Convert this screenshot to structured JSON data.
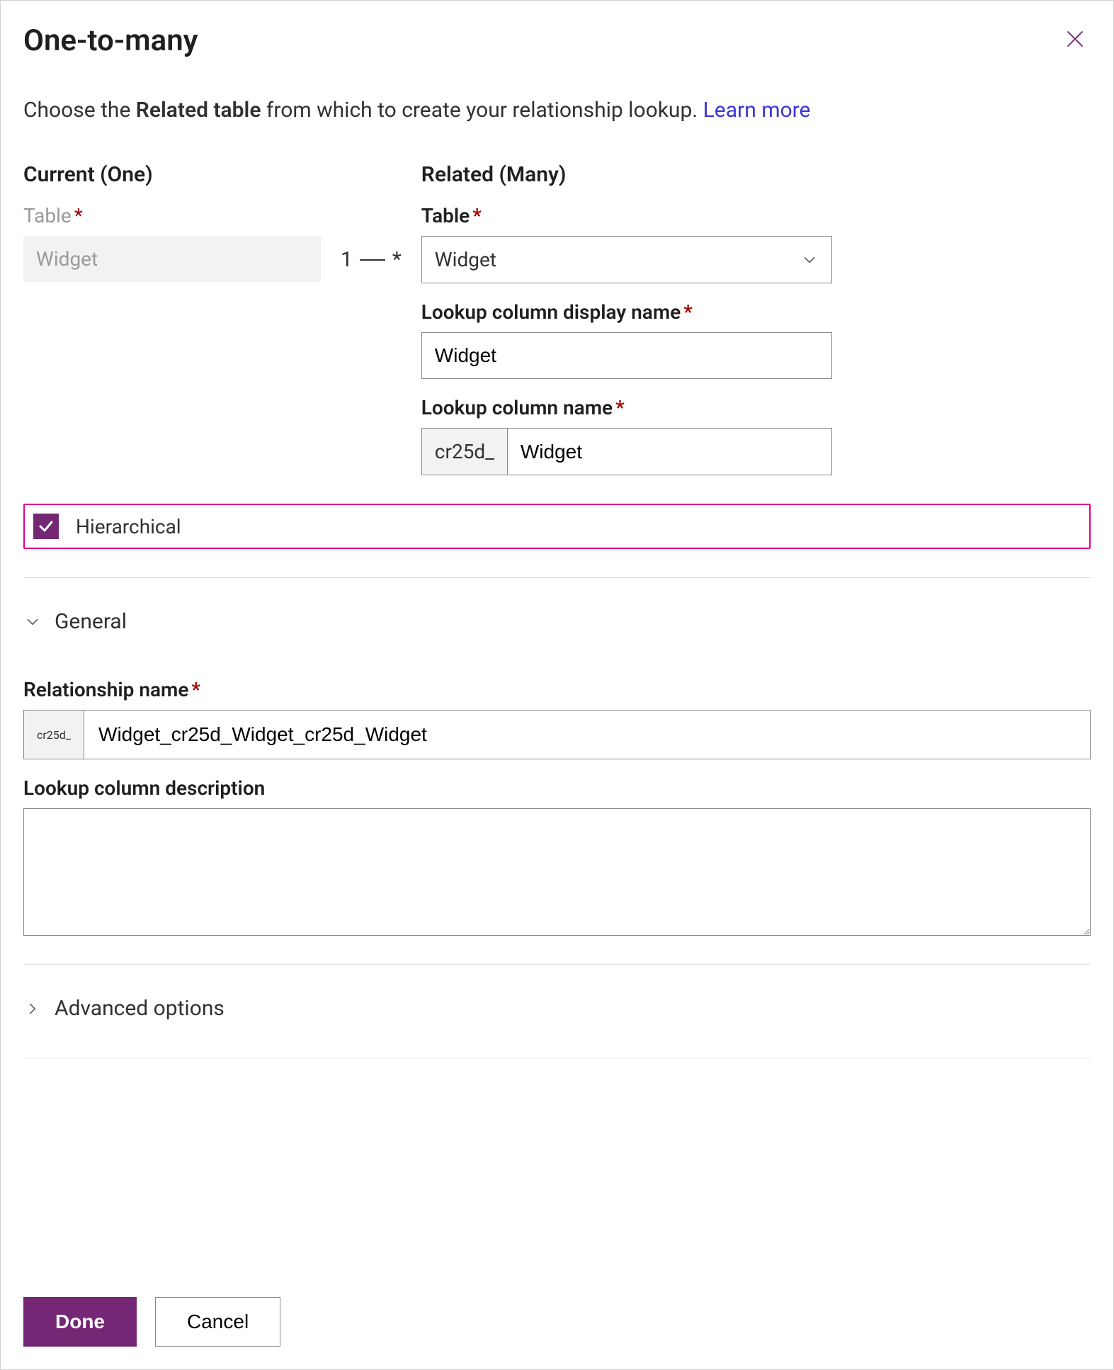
{
  "header": {
    "title": "One-to-many"
  },
  "intro": {
    "prefix": "Choose the ",
    "bold": "Related table",
    "suffix": " from which to create your relationship lookup. ",
    "link": "Learn more"
  },
  "relation": {
    "one": "1",
    "many": "*"
  },
  "current": {
    "heading": "Current (One)",
    "table_label": "Table",
    "table_value": "Widget"
  },
  "related": {
    "heading": "Related (Many)",
    "table_label": "Table",
    "table_value": "Widget",
    "lookup_display_label": "Lookup column display name",
    "lookup_display_value": "Widget",
    "lookup_name_label": "Lookup column name",
    "lookup_name_prefix": "cr25d_",
    "lookup_name_value": "Widget"
  },
  "hierarchical": {
    "label": "Hierarchical",
    "checked": true
  },
  "general": {
    "heading": "General",
    "rel_name_label": "Relationship name",
    "rel_name_prefix": "cr25d_",
    "rel_name_value": "Widget_cr25d_Widget_cr25d_Widget",
    "desc_label": "Lookup column description",
    "desc_value": ""
  },
  "advanced": {
    "heading": "Advanced options"
  },
  "footer": {
    "done": "Done",
    "cancel": "Cancel"
  }
}
